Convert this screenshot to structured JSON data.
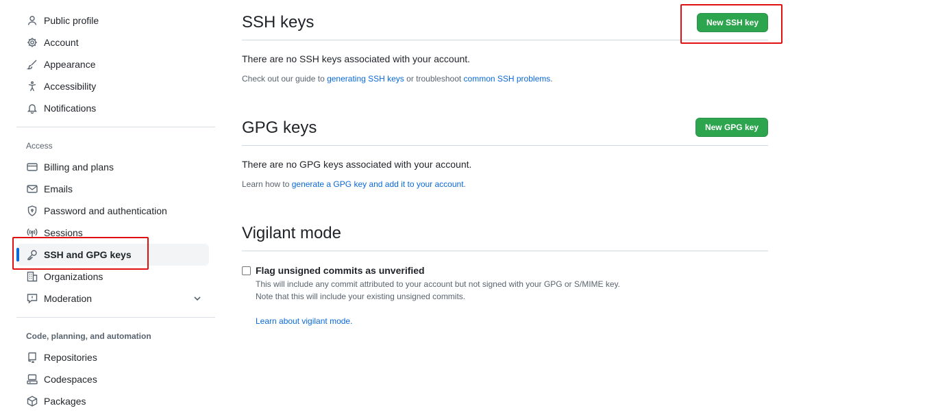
{
  "sidebar": {
    "items_top": [
      {
        "label": "Public profile",
        "icon": "person-icon"
      },
      {
        "label": "Account",
        "icon": "gear-icon"
      },
      {
        "label": "Appearance",
        "icon": "paintbrush-icon"
      },
      {
        "label": "Accessibility",
        "icon": "accessibility-icon"
      },
      {
        "label": "Notifications",
        "icon": "bell-icon"
      }
    ],
    "access_label": "Access",
    "items_access": [
      {
        "label": "Billing and plans",
        "icon": "credit-card-icon"
      },
      {
        "label": "Emails",
        "icon": "mail-icon"
      },
      {
        "label": "Password and authentication",
        "icon": "shield-lock-icon"
      },
      {
        "label": "Sessions",
        "icon": "broadcast-icon"
      },
      {
        "label": "SSH and GPG keys",
        "icon": "key-icon",
        "active": true
      },
      {
        "label": "Organizations",
        "icon": "organization-icon"
      },
      {
        "label": "Moderation",
        "icon": "report-icon"
      }
    ],
    "code_label": "Code, planning, and automation",
    "items_code": [
      {
        "label": "Repositories",
        "icon": "repo-icon"
      },
      {
        "label": "Codespaces",
        "icon": "codespaces-icon"
      },
      {
        "label": "Packages",
        "icon": "package-icon"
      }
    ]
  },
  "ssh": {
    "title": "SSH keys",
    "button": "New SSH key",
    "empty": "There are no SSH keys associated with your account.",
    "guide_prefix": "Check out our guide to ",
    "guide_link1": "generating SSH keys",
    "guide_mid": " or troubleshoot ",
    "guide_link2": "common SSH problems",
    "guide_suffix": "."
  },
  "gpg": {
    "title": "GPG keys",
    "button": "New GPG key",
    "empty": "There are no GPG keys associated with your account.",
    "learn_prefix": "Learn how to ",
    "learn_link": "generate a GPG key and add it to your account",
    "learn_suffix": "."
  },
  "vigilant": {
    "title": "Vigilant mode",
    "checkbox_label": "Flag unsigned commits as unverified",
    "note1": "This will include any commit attributed to your account but not signed with your GPG or S/MIME key.",
    "note2": "Note that this will include your existing unsigned commits.",
    "learn_link": "Learn about vigilant mode."
  },
  "colors": {
    "accent": "#0969da",
    "button_green": "#2da44e",
    "annotation_red": "#e01010"
  }
}
